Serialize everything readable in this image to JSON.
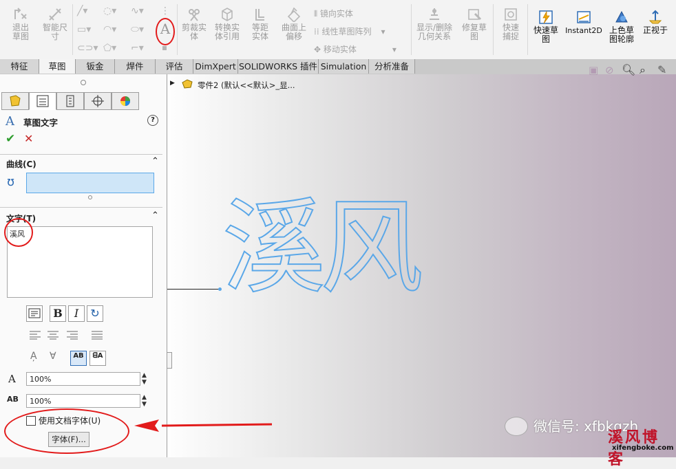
{
  "ribbon": {
    "exit_sketch": "退出草图",
    "smart_dim": "智能尺寸",
    "trim": "剪裁实体",
    "convert": "转换实体引用",
    "offset": "等距实体",
    "surface_offset": "曲面上偏移",
    "mirror": "镜向实体",
    "linear_pattern": "线性草图阵列",
    "move": "移动实体",
    "show_relations": "显示/删除几何关系",
    "repair": "修复草图",
    "quick_snap": "快速捕捉",
    "rapid_sketch": "快速草图",
    "instant2d": "Instant2D",
    "shaded_sketch": "上色草图轮廓",
    "normal_to": "正视于"
  },
  "tabs": [
    "特征",
    "草图",
    "钣金",
    "焊件",
    "评估",
    "DimXpert",
    "SOLIDWORKS 插件",
    "Simulation",
    "分析准备"
  ],
  "tree": {
    "part_label": "零件2 (默认<<默认>_显..."
  },
  "panel": {
    "title": "草图文字",
    "curve_section": "曲线(C)",
    "text_section": "文字(T)",
    "text_value": "溪风",
    "width_factor": "100%",
    "spacing": "100%",
    "doc_font_label": "使用文档字体(U)",
    "font_button": "字体(F)..."
  },
  "canvas": {
    "sketch_text": "溪风"
  },
  "watermark": {
    "wechat": "微信号: xfbkgzh",
    "blog_name": "溪风博客",
    "site": "xifengboke.com"
  },
  "colors": {
    "accent_red": "#e21b1b",
    "sketch_blue": "#5aa7e8",
    "selected_field": "#cfe6f8"
  }
}
